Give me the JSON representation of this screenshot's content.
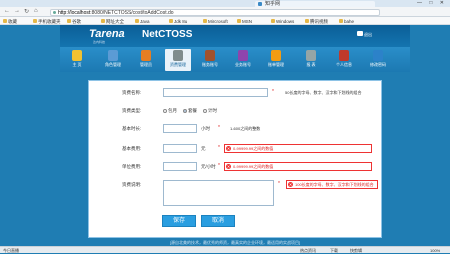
{
  "browser": {
    "tab_title": "知乎网",
    "url_host": "http://localhost",
    "url_path": ":8080/NETCTOSS/cost/toAddCost.do",
    "window_controls": "— □ ✕",
    "bookmarks": [
      "收藏",
      "手机收藏夹",
      "谷歌",
      "网址大全",
      "Java",
      "Jdk 8u",
      "Mircrosoft",
      "MSN",
      "Windows",
      "腾讯视频",
      "bahe"
    ],
    "nav_back": "←",
    "nav_forward": "→",
    "nav_refresh": "↻",
    "nav_home": "⌂"
  },
  "app": {
    "logo": "Tarena",
    "logo_sub": "达内科技",
    "title": "NetCTOSS",
    "user": "退出"
  },
  "nav": [
    {
      "label": "主 页",
      "color": "#f1c232",
      "active": false
    },
    {
      "label": "角色管理",
      "color": "#5b9bd5",
      "active": false
    },
    {
      "label": "管理员",
      "color": "#e67e22",
      "active": false
    },
    {
      "label": "资费管理",
      "color": "#7f8c8d",
      "active": true
    },
    {
      "label": "账务账号",
      "color": "#a0522d",
      "active": false
    },
    {
      "label": "业务账号",
      "color": "#8e44ad",
      "active": false
    },
    {
      "label": "账单管理",
      "color": "#f39c12",
      "active": false
    },
    {
      "label": "报 表",
      "color": "#95a5a6",
      "active": false
    },
    {
      "label": "个人信息",
      "color": "#c0392b",
      "active": false
    },
    {
      "label": "修改密码",
      "color": "#2c82c9",
      "active": false
    }
  ],
  "form": {
    "name_label": "资费名称:",
    "name_hint": "50长度的字母、数字、汉字和下划线的组合",
    "type_label": "资费类型:",
    "type_options": [
      "包月",
      "套餐",
      "计时"
    ],
    "type_selected": 1,
    "base_duration_label": "基本时长:",
    "base_duration_unit": "小时",
    "base_duration_hint": "1-600之间的整数",
    "base_cost_label": "基本费用:",
    "base_cost_unit": "元",
    "base_cost_error": "0-99999.99之间的数值",
    "unit_cost_label": "单位费用:",
    "unit_cost_unit": "元/小时",
    "unit_cost_error": "0-99999.99之间的数值",
    "desc_label": "资费说明:",
    "desc_error": "100长度的字母、数字、汉字和下划线的组合",
    "required_mark": "*",
    "save": "保存",
    "cancel": "取消"
  },
  "footer": "[源自北美的技术，最优秀的师资，最真实的企业环境，最适用的实战项目]",
  "taskbar": {
    "left": "今日直播",
    "items": [
      "热点资讯",
      "下载",
      "快剪辑",
      "100%"
    ]
  }
}
